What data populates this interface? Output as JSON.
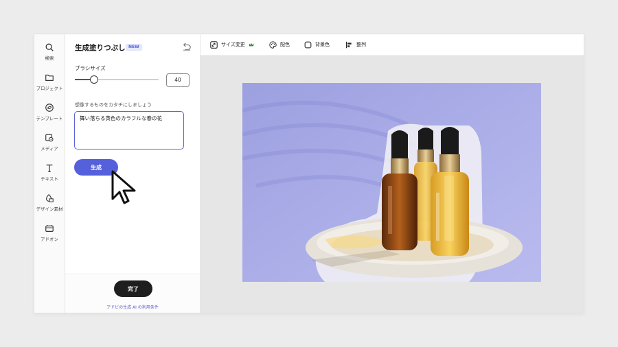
{
  "rail": {
    "items": [
      {
        "label": "検索",
        "icon": "search-icon"
      },
      {
        "label": "プロジェクト",
        "icon": "folder-icon"
      },
      {
        "label": "テンプレート",
        "icon": "template-icon"
      },
      {
        "label": "メディア",
        "icon": "media-icon"
      },
      {
        "label": "テキスト",
        "icon": "text-icon"
      },
      {
        "label": "デザイン素材",
        "icon": "shapes-icon"
      },
      {
        "label": "アドオン",
        "icon": "addon-icon"
      }
    ]
  },
  "panel": {
    "title": "生成塗りつぶし",
    "badge": "NEW",
    "brush_label": "ブラシサイズ",
    "brush_size": "40",
    "brush_level": 0.23,
    "prompt_label": "想像するものをカタチにしましょう",
    "prompt_value": "舞い落ちる黄色のカラフルな春の花",
    "generate_label": "生成",
    "done_label": "完了",
    "terms_link": "アドビの生成 AI の利用条件"
  },
  "toolbar": {
    "resize": "サイズ変更",
    "color": "配色",
    "background": "背景色",
    "align": "整列"
  },
  "colors": {
    "accent": "#5560db",
    "photo_bg": "#a6a8e6"
  }
}
